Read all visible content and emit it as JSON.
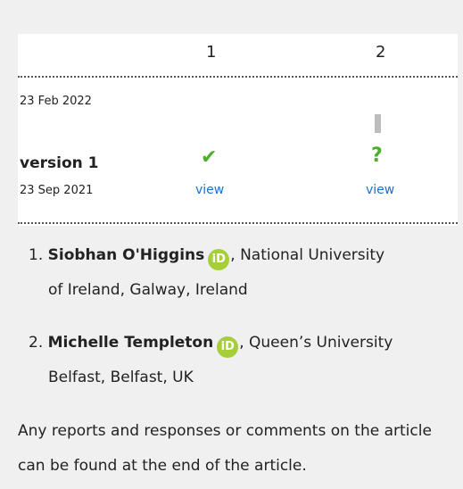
{
  "versions_table": {
    "columns": [
      "1",
      "2"
    ],
    "latest_date": "23 Feb 2022",
    "version": {
      "label": "version 1",
      "date": "23 Sep 2021",
      "reviews": [
        {
          "status": "approved",
          "mark": "✔",
          "link": "view",
          "color": "#4caf2b"
        },
        {
          "status": "approved-with-reservations",
          "mark": "?",
          "link": "view",
          "color": "#4caf2b"
        }
      ]
    }
  },
  "reviewers": [
    {
      "number": "1.",
      "name": "Siobhan O'Higgins",
      "orcid_icon_text": "iD",
      "affiliation_line1": ", National University",
      "affiliation_line2": "of Ireland, Galway, Ireland"
    },
    {
      "number": "2.",
      "name": "Michelle Templeton",
      "orcid_icon_text": "iD",
      "affiliation_line1": ", Queen’s University",
      "affiliation_line2": "Belfast, Belfast, UK"
    }
  ],
  "footer_note": "Any reports and responses or comments on the article can be found at the end of the article.",
  "colors": {
    "background": "#f0f0f0",
    "panel": "#ffffff",
    "approved_green": "#4caf2b",
    "link_blue": "#1a73c8",
    "orcid_green": "#a6ce39"
  }
}
